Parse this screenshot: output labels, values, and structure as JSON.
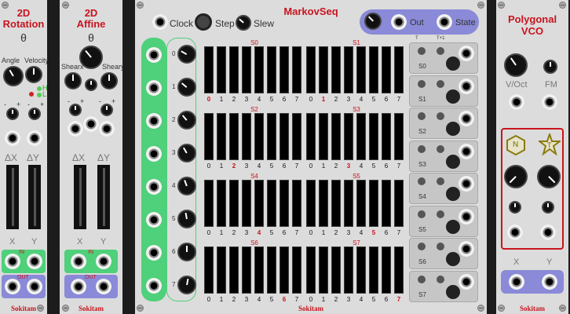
{
  "rotation": {
    "title_l1": "2D",
    "title_l2": "Rotation",
    "theta": "θ",
    "angle_label": "Angle",
    "velocity_label": "Velocity",
    "h_label": "H",
    "l_label": "L",
    "minus": "-",
    "plus": "+",
    "dx": "ΔX",
    "dy": "ΔY",
    "x": "X",
    "y": "Y",
    "in": "IN",
    "out": "OUT",
    "brand": "Sokitam"
  },
  "affine": {
    "title_l1": "2D",
    "title_l2": "Affine",
    "theta": "θ",
    "shearx": "Shearx",
    "sheary": "Sheary",
    "minus": "-",
    "plus": "+",
    "dx": "ΔX",
    "dy": "ΔY",
    "x": "X",
    "y": "Y",
    "in": "IN",
    "out": "OUT",
    "brand": "Sokitam"
  },
  "markov": {
    "title": "MarkovSeq",
    "clock": "Clock",
    "step": "Step",
    "slew": "Slew",
    "out": "Out",
    "state": "State",
    "t": "T",
    "t1": "T+1",
    "brand": "Sokitam",
    "state_rows": [
      "0",
      "1",
      "2",
      "3",
      "4",
      "5",
      "6",
      "7"
    ],
    "matrices": [
      {
        "label": "S0",
        "sel": 0
      },
      {
        "label": "S1",
        "sel": 1
      },
      {
        "label": "S2",
        "sel": 2
      },
      {
        "label": "S3",
        "sel": 3
      },
      {
        "label": "S4",
        "sel": 4
      },
      {
        "label": "S5",
        "sel": 5
      },
      {
        "label": "S6",
        "sel": 6
      },
      {
        "label": "S7",
        "sel": 7
      }
    ],
    "cols": [
      "0",
      "1",
      "2",
      "3",
      "4",
      "5",
      "6",
      "7"
    ],
    "side_rows": [
      "S0",
      "S1",
      "S2",
      "S3",
      "S4",
      "S5",
      "S6",
      "S7"
    ]
  },
  "vco": {
    "title_l1": "Polygonal",
    "title_l2": "VCO",
    "voct": "V/Oct",
    "fm": "FM",
    "n": "N",
    "t": "T",
    "x": "X",
    "y": "Y",
    "brand": "Sokitam"
  },
  "colors": {
    "accent_red": "#c8141e",
    "green": "#4fd07a",
    "blue": "#8a8ad8"
  }
}
